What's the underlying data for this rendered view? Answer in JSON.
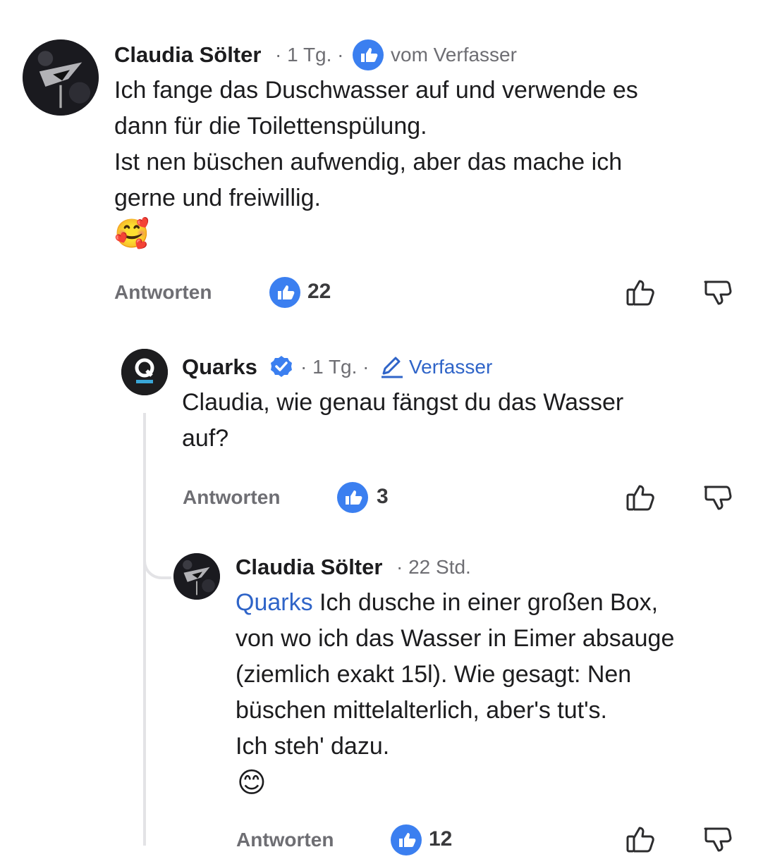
{
  "comments": [
    {
      "author": "Claudia Sölter",
      "time": "· 1 Tg. ·",
      "badge_label": "vom Verfasser",
      "text": "Ich fange das Duschwasser auf und verwende es\ndann für die Toilettenspülung.\nIst nen büschen aufwendig, aber das mache ich\ngerne und freiwillig.",
      "emoji": "🥰",
      "reply_label": "Antworten",
      "likes": "22"
    },
    {
      "author": "Quarks",
      "time": "· 1 Tg. ·",
      "badge_label": "Verfasser",
      "text": "Claudia, wie genau fängst du das Wasser\nauf?",
      "reply_label": "Antworten",
      "likes": "3"
    },
    {
      "author": "Claudia Sölter",
      "time": "· 22 Std.",
      "mention": "Quarks",
      "text": " Ich dusche in einer großen Box,\nvon wo ich das Wasser in Eimer absauge\n(ziemlich exakt 15l). Wie gesagt: Nen\nbüschen mittelalterlich, aber's tut's.\nIch steh' dazu.",
      "emoji": "😊",
      "reply_label": "Antworten",
      "likes": "12"
    }
  ],
  "colors": {
    "accent_blue": "#2f64c8",
    "like_blue": "#3b7ff0",
    "meta_gray": "#6e6e73"
  },
  "icons": [
    "like-badge-icon",
    "thumbs-up-icon",
    "thumbs-down-icon",
    "verified-icon",
    "pencil-icon",
    "q-logo-icon"
  ]
}
